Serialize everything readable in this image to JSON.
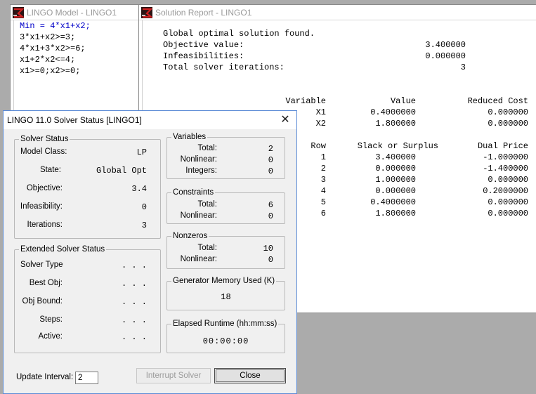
{
  "model_window": {
    "title": "LINGO Model - LINGO1",
    "lines": [
      {
        "kw": "Min",
        "rest": " = 4*x1+x2;"
      },
      {
        "kw": "",
        "rest": "3*x1+x2>=3;"
      },
      {
        "kw": "",
        "rest": "4*x1+3*x2>=6;"
      },
      {
        "kw": "",
        "rest": "x1+2*x2<=4;"
      },
      {
        "kw": "",
        "rest": "x1>=0;x2>=0;"
      }
    ]
  },
  "solution_window": {
    "title": "Solution Report - LINGO1",
    "summary": {
      "status": "Global optimal solution found.",
      "objective_label": "Objective value:",
      "objective_value": "3.400000",
      "infeas_label": "Infeasibilities:",
      "infeas_value": "0.000000",
      "iter_label": "Total solver iterations:",
      "iter_value": "3"
    },
    "variables": {
      "headers": [
        "Variable",
        "Value",
        "Reduced Cost"
      ],
      "rows": [
        [
          "X1",
          "0.4000000",
          "0.000000"
        ],
        [
          "X2",
          "1.800000",
          "0.000000"
        ]
      ]
    },
    "rows": {
      "headers": [
        "Row",
        "Slack or Surplus",
        "Dual Price"
      ],
      "rows": [
        [
          "1",
          "3.400000",
          "-1.000000"
        ],
        [
          "2",
          "0.000000",
          "-1.400000"
        ],
        [
          "3",
          "1.000000",
          "0.000000"
        ],
        [
          "4",
          "0.000000",
          "0.2000000"
        ],
        [
          "5",
          "0.4000000",
          "0.000000"
        ],
        [
          "6",
          "1.800000",
          "0.000000"
        ]
      ]
    }
  },
  "dialog": {
    "title": "LINGO 11.0 Solver Status [LINGO1]",
    "close_glyph": "✕",
    "solver_status": {
      "legend": "Solver Status",
      "model_class_label": "Model Class:",
      "model_class": "LP",
      "state_label": "State:",
      "state": "Global Opt",
      "objective_label": "Objective:",
      "objective": "3.4",
      "infeasibility_label": "Infeasibility:",
      "infeasibility": "0",
      "iterations_label": "Iterations:",
      "iterations": "3"
    },
    "extended": {
      "legend": "Extended Solver Status",
      "solver_type_label": "Solver Type",
      "solver_type": ". . .",
      "best_obj_label": "Best Obj:",
      "best_obj": ". . .",
      "obj_bound_label": "Obj Bound:",
      "obj_bound": ". . .",
      "steps_label": "Steps:",
      "steps": ". . .",
      "active_label": "Active:",
      "active": ". . ."
    },
    "variables": {
      "legend": "Variables",
      "total_label": "Total:",
      "total": "2",
      "nonlinear_label": "Nonlinear:",
      "nonlinear": "0",
      "integers_label": "Integers:",
      "integers": "0"
    },
    "constraints": {
      "legend": "Constraints",
      "total_label": "Total:",
      "total": "6",
      "nonlinear_label": "Nonlinear:",
      "nonlinear": "0"
    },
    "nonzeros": {
      "legend": "Nonzeros",
      "total_label": "Total:",
      "total": "10",
      "nonlinear_label": "Nonlinear:",
      "nonlinear": "0"
    },
    "memory": {
      "legend": "Generator Memory Used (K)",
      "value": "18"
    },
    "runtime": {
      "legend": "Elapsed Runtime (hh:mm:ss)",
      "value": "00:00:00"
    },
    "update_interval_label": "Update Interval:",
    "update_interval_value": "2",
    "interrupt_label": "Interrupt Solver",
    "close_label": "Close"
  }
}
